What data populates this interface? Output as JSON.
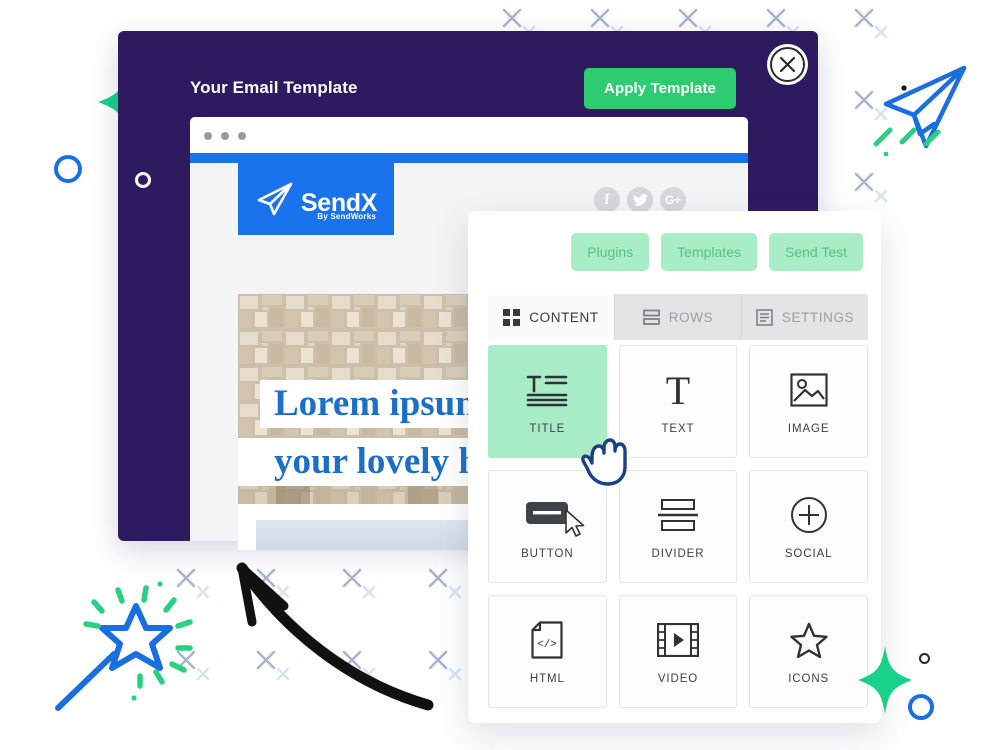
{
  "modal": {
    "title": "Your Email Template",
    "apply_label": "Apply Template",
    "close_icon": "close-x-icon",
    "back_icon": "chevron-left-icon",
    "bullet_icon": "circle-outline-icon",
    "purple": "#2e1a5e",
    "green": "#2ecc71"
  },
  "browser": {
    "dots": 3,
    "accent_strip": "#1a73ec"
  },
  "email": {
    "brand": "SendX",
    "brand_sub": "By SendWorks",
    "brand_icon": "paper-plane-icon",
    "socials": [
      {
        "name": "facebook-icon",
        "glyph": "f"
      },
      {
        "name": "twitter-icon",
        "glyph": "t"
      },
      {
        "name": "google-plus-icon",
        "glyph": "G+"
      }
    ],
    "hero_line_1": "Lorem ipsum",
    "hero_line_2": "your lovely ho",
    "hero_color": "#1b6fc7"
  },
  "editor": {
    "actions": [
      {
        "label": "Plugins",
        "name": "plugins-button"
      },
      {
        "label": "Templates",
        "name": "templates-button"
      },
      {
        "label": "Send Test",
        "name": "send-test-button"
      }
    ],
    "tabs": [
      {
        "label": "CONTENT",
        "icon": "grid-icon",
        "active": true
      },
      {
        "label": "ROWS",
        "icon": "rows-icon",
        "active": false
      },
      {
        "label": "SETTINGS",
        "icon": "settings-panel-icon",
        "active": false
      }
    ],
    "tiles": [
      {
        "label": "TITLE",
        "icon": "title-icon",
        "selected": true
      },
      {
        "label": "TEXT",
        "icon": "text-t-icon",
        "selected": false
      },
      {
        "label": "IMAGE",
        "icon": "image-icon",
        "selected": false
      },
      {
        "label": "BUTTON",
        "icon": "button-icon",
        "selected": false
      },
      {
        "label": "DIVIDER",
        "icon": "divider-icon",
        "selected": false
      },
      {
        "label": "SOCIAL",
        "icon": "social-plus-icon",
        "selected": false
      },
      {
        "label": "HTML",
        "icon": "html-code-icon",
        "selected": false
      },
      {
        "label": "VIDEO",
        "icon": "video-icon",
        "selected": false
      },
      {
        "label": "ICONS",
        "icon": "star-icon",
        "selected": false
      }
    ],
    "selected_color": "#a9edc6",
    "pill_text_color": "#57c184"
  },
  "decorations": [
    {
      "name": "green-sparkle-left",
      "color": "#18d18a"
    },
    {
      "name": "green-sparkle-right",
      "color": "#18d18a"
    },
    {
      "name": "blue-ring-left",
      "color": "#1a6fe0"
    },
    {
      "name": "blue-ring-right",
      "color": "#1a6fe0"
    },
    {
      "name": "white-ring",
      "color": "#ffffff"
    },
    {
      "name": "dark-ring",
      "color": "#2b2150"
    },
    {
      "name": "paper-plane-doodle",
      "color": "#1a6fe0"
    },
    {
      "name": "magic-wand-doodle",
      "color": "#1a6fe0"
    },
    {
      "name": "curved-arrow-doodle",
      "color": "#111111"
    },
    {
      "name": "x-pattern",
      "color": "#9aa6c4"
    }
  ],
  "cursors": [
    {
      "name": "hand-pointer-cursor",
      "color": "#1c3f86"
    },
    {
      "name": "arrow-cursor",
      "color": "#ffffff"
    }
  ]
}
